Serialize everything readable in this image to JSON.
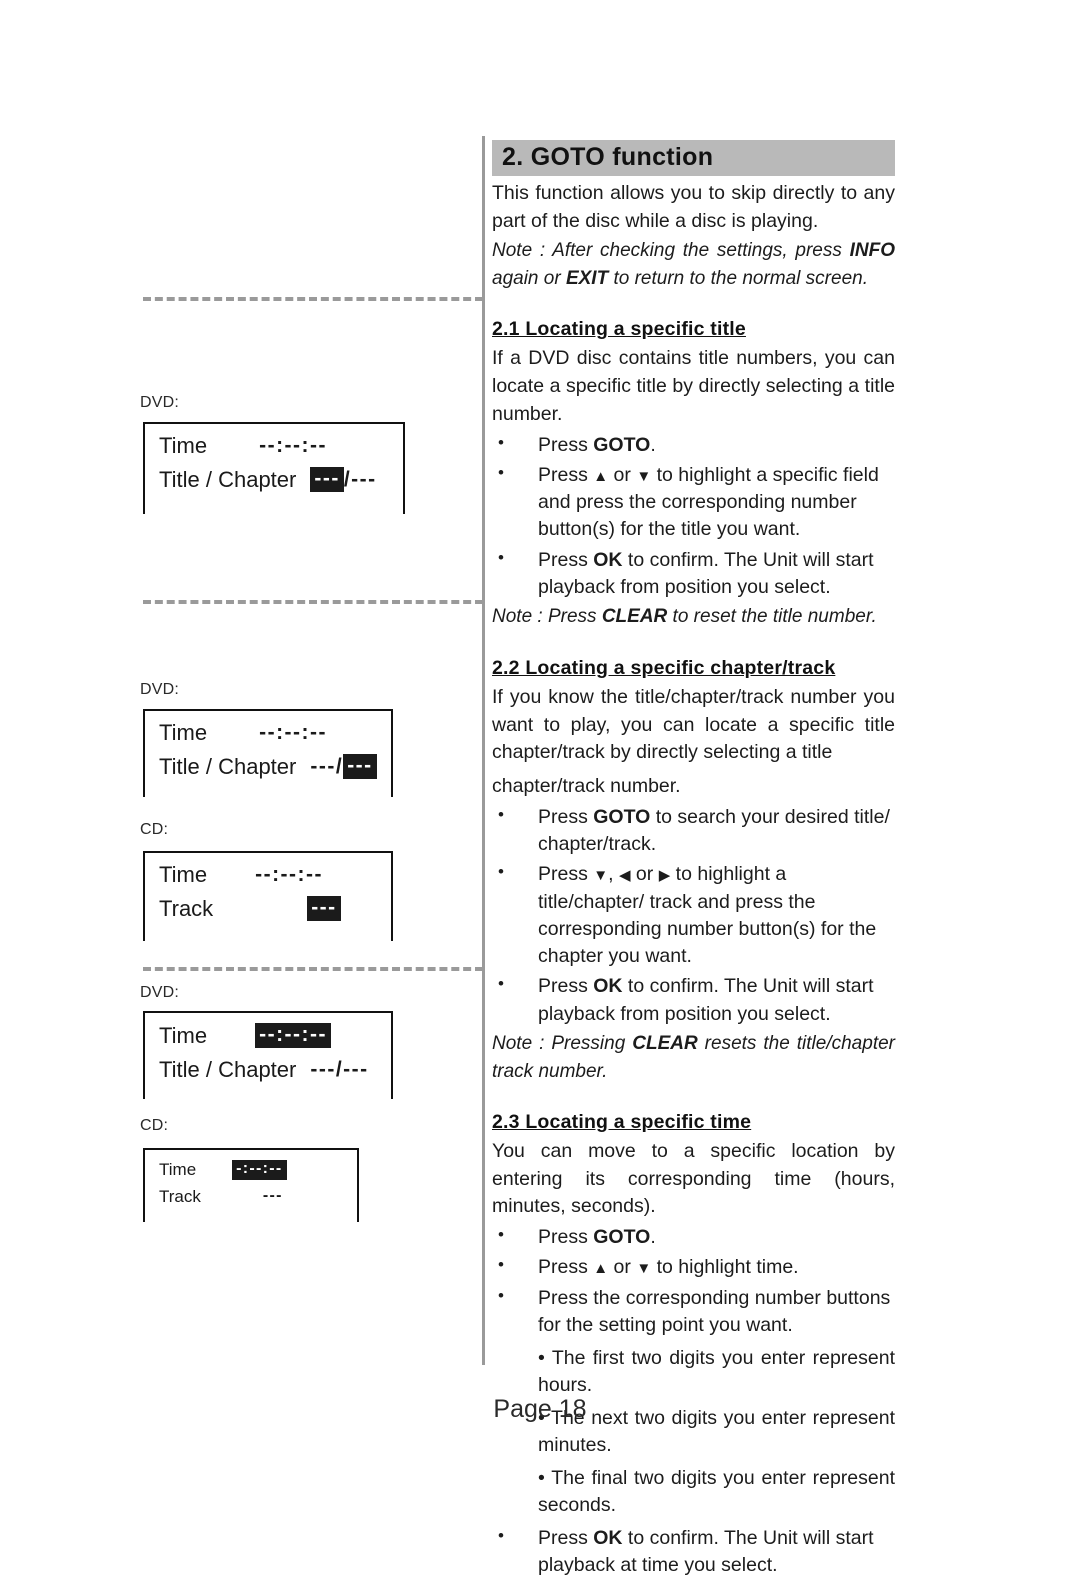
{
  "document": {
    "footer": "Page 18"
  },
  "section": {
    "bar_title": "2.  GOTO function",
    "intro": "This function allows you to skip directly to any part of the disc while a disc is playing.",
    "intro_note_1": "Note : After checking the settings, press ",
    "intro_note_kw1": "INFO",
    "intro_note_2": " again or ",
    "intro_note_kw2": "EXIT",
    "intro_note_3": " to return to the normal screen."
  },
  "sub_2_1": {
    "heading": "2.1  Locating a specific title",
    "body": "If a DVD disc contains title numbers, you can locate a specific title by directly selecting a title number.",
    "bullets": [
      {
        "pre": "Press ",
        "kw": "GOTO",
        "post": "."
      },
      {
        "pre": "Press ",
        "glyph1": "▲",
        "mid": " or ",
        "glyph2": "▼",
        "post": " to highlight a specific field and press the corresponding number button(s) for the title you want."
      },
      {
        "pre": "Press ",
        "kw": "OK",
        "post": " to confirm. The Unit will start playback from position you select."
      }
    ],
    "note_1": "Note : Press ",
    "note_kw": "CLEAR",
    "note_2": " to reset the title number."
  },
  "sub_2_2": {
    "heading": "2.2  Locating a specific chapter/track",
    "body_a": "If you know the title/chapter/track number you want to play,  you can locate a specific title chapter/track by directly selecting a title",
    "body_b": "chapter/track number.",
    "bullets": [
      {
        "pre": "Press ",
        "kw": "GOTO",
        "post": " to search your desired title/ chapter/track."
      },
      {
        "pre": "Press ",
        "glyph1": "▼",
        "mid": ", ",
        "glyph2": "◀",
        "mid2": " or ",
        "glyph3": "▶",
        "post": " to highlight a title/chapter/ track and press the corresponding number button(s) for the chapter you want."
      },
      {
        "pre": "Press ",
        "kw": "OK",
        "post": " to confirm. The Unit will start playback from position you select."
      }
    ],
    "note_1": "Note : Pressing ",
    "note_kw": "CLEAR",
    "note_2": " resets the title/chapter track number."
  },
  "sub_2_3": {
    "heading": "2.3  Locating a specific time",
    "body": "You can move to a specific location by entering its corresponding time (hours, minutes, seconds).",
    "bullets": [
      {
        "pre": "Press ",
        "kw": "GOTO",
        "post": "."
      },
      {
        "pre": "Press ",
        "glyph1": "▲",
        "mid": " or ",
        "glyph2": "▼",
        "post": " to highlight time."
      },
      {
        "pre": "Press the corresponding number buttons for the setting point you want.",
        "kw": "",
        "post": ""
      }
    ],
    "sub_bullets": [
      "•  The first two digits you enter represent hours.",
      "•  The next two digits you enter represent minutes.",
      "•  The final two digits you enter represent seconds."
    ],
    "last_bullet": {
      "pre": "Press ",
      "kw": "OK",
      "post": " to confirm. The Unit will start playback at time you select."
    }
  },
  "osd_groups": [
    {
      "group_id": "title-highlight",
      "panels": [
        {
          "disc_label": "DVD:",
          "rows": [
            {
              "label": "Time",
              "value": "--:--:--",
              "highlighted": false
            },
            {
              "label": "Title / Chapter",
              "value": "---",
              "highlighted": true,
              "suffix": "/---"
            }
          ]
        }
      ]
    },
    {
      "group_id": "chapter-track-highlight",
      "panels": [
        {
          "disc_label": "DVD:",
          "rows": [
            {
              "label": "Time",
              "value": "--:--:--",
              "highlighted": false
            },
            {
              "label": "Title / Chapter",
              "prefix": "---/",
              "value": "---",
              "highlighted": true
            }
          ]
        },
        {
          "disc_label": "CD:",
          "rows": [
            {
              "label": "Time",
              "value": "--:--:--",
              "highlighted": false
            },
            {
              "label": "Track",
              "value": "---",
              "highlighted": true
            }
          ]
        }
      ]
    },
    {
      "group_id": "time-highlight",
      "panels": [
        {
          "disc_label": "DVD:",
          "rows": [
            {
              "label": "Time",
              "value": "--:--:--",
              "highlighted": true
            },
            {
              "label": "Title / Chapter",
              "value": "---/---",
              "highlighted": false
            }
          ]
        },
        {
          "disc_label": "CD:",
          "rows": [
            {
              "label": "Time",
              "value": "-:--:--",
              "highlighted": true
            },
            {
              "label": "Track",
              "value": "---",
              "highlighted": false
            }
          ]
        }
      ]
    }
  ],
  "colors": {
    "section_bar_bg": "#b9b9b9",
    "divider": "#9a9a9a",
    "highlight_bg": "#1b1b1b",
    "highlight_fg": "#ffffff",
    "text": "#1c1c1c"
  }
}
